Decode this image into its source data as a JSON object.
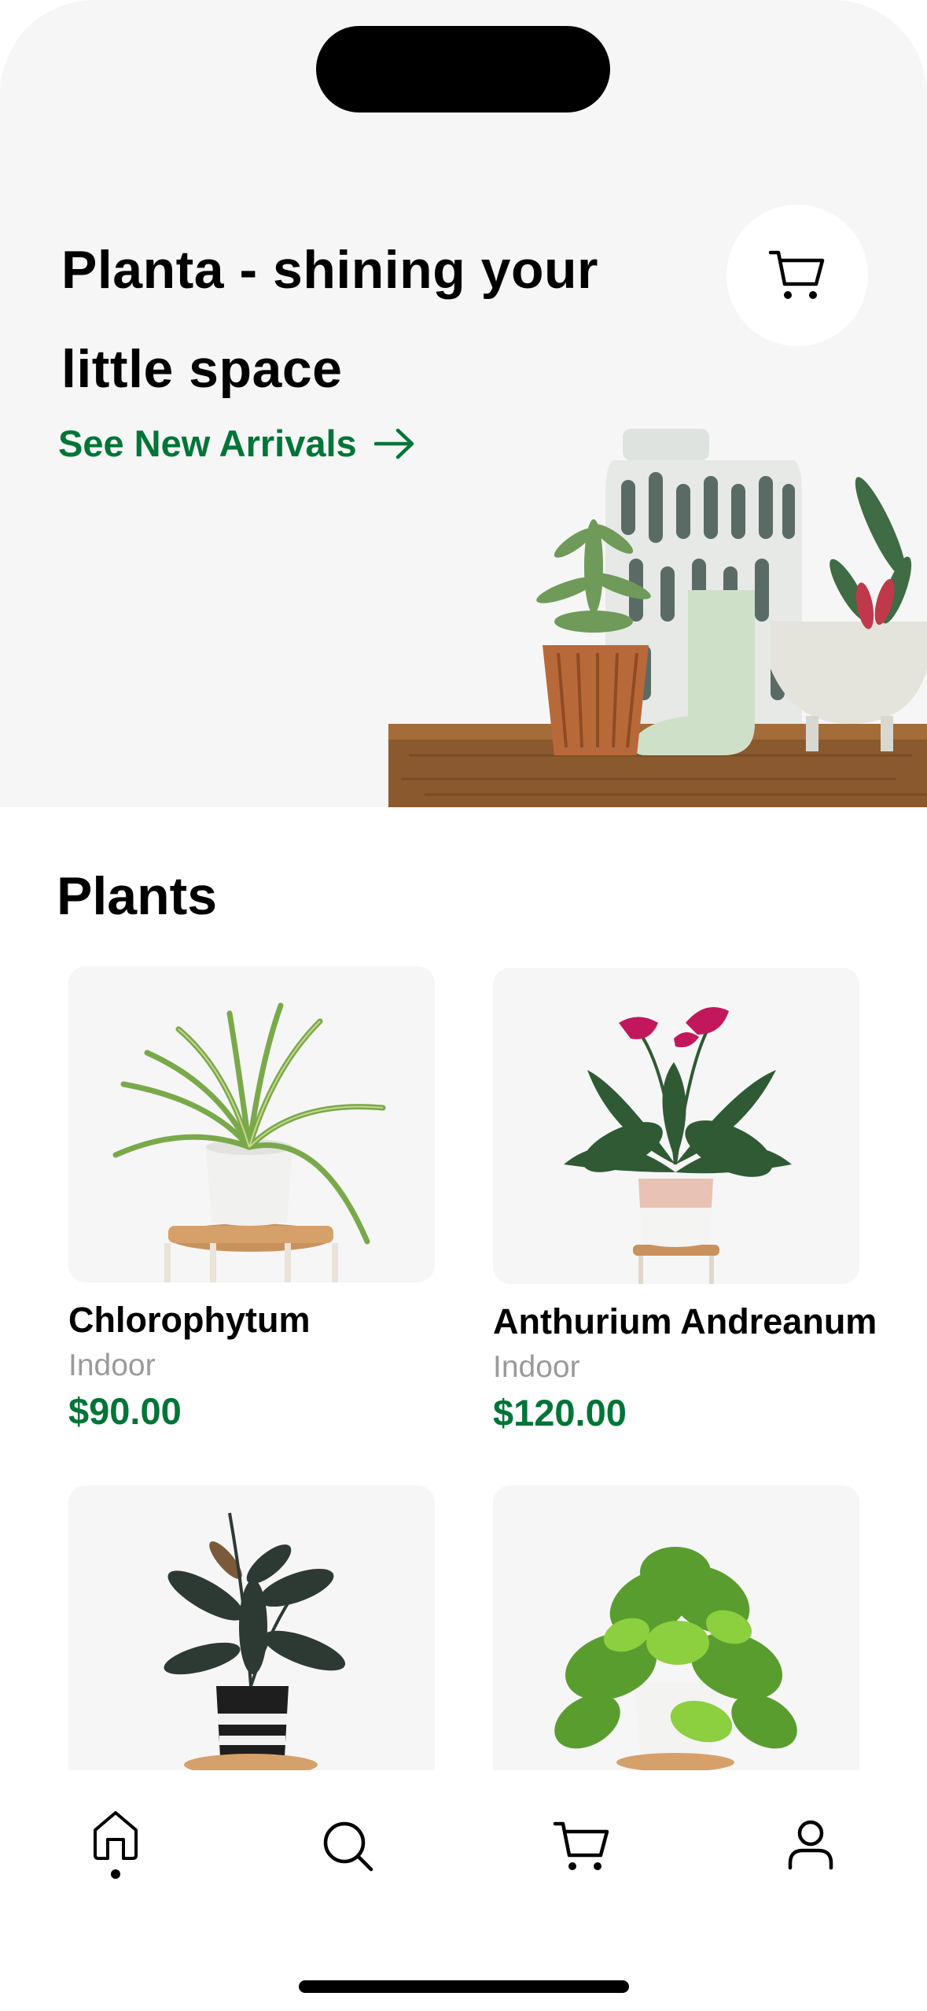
{
  "hero": {
    "title": "Planta - shining your little space",
    "link_label": "See New Arrivals",
    "cart_icon": "cart-icon",
    "background": "#f6f6f6"
  },
  "colors": {
    "accent": "#007537",
    "muted": "#9a9a9a",
    "text": "#000000"
  },
  "section": {
    "title": "Plants"
  },
  "products": [
    {
      "name": "Chlorophytum",
      "category": "Indoor",
      "price": "$90.00"
    },
    {
      "name": "Anthurium Andreanum",
      "category": "Indoor",
      "price": "$120.00"
    },
    {
      "name": "",
      "category": "",
      "price": ""
    },
    {
      "name": "",
      "category": "",
      "price": ""
    }
  ],
  "tabbar": {
    "items": [
      {
        "icon": "home-icon",
        "active": true
      },
      {
        "icon": "search-icon",
        "active": false
      },
      {
        "icon": "cart-icon",
        "active": false
      },
      {
        "icon": "user-icon",
        "active": false
      }
    ]
  }
}
